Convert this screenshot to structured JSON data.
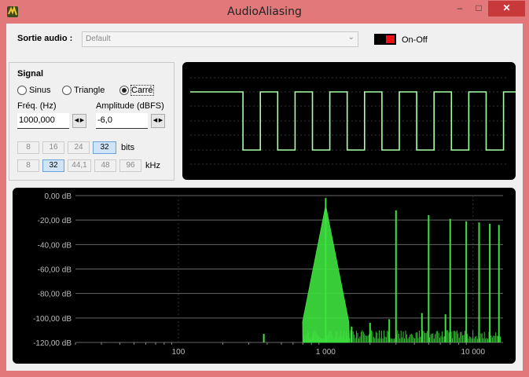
{
  "window": {
    "title": "AudioAliasing",
    "min_glyph": "–",
    "max_glyph": "□",
    "close_glyph": "✕"
  },
  "top": {
    "sortie_label": "Sortie audio :",
    "device": "Default",
    "onoff_label": "On-Off"
  },
  "signal": {
    "title": "Signal",
    "waveforms": [
      {
        "label": "Sinus",
        "checked": false
      },
      {
        "label": "Triangle",
        "checked": false
      },
      {
        "label": "Carré",
        "checked": true
      }
    ],
    "freq_label": "Fréq. (Hz)",
    "freq_value": "1000,000",
    "amp_label": "Amplitude (dBFS)",
    "amp_value": "-6,0",
    "bits_options": [
      "8",
      "16",
      "24",
      "32"
    ],
    "bits_selected": "32",
    "bits_label": "bits",
    "khz_options": [
      "8",
      "32",
      "44,1",
      "48",
      "96"
    ],
    "khz_selected": "32",
    "khz_label": "kHz"
  },
  "colors": {
    "trace": "#3ee23e",
    "oscillo_trace": "#a8ffa8",
    "grid": "#555555",
    "background": "#000000",
    "label": "#bbbbbb"
  },
  "chart_data": [
    {
      "type": "line",
      "title": "",
      "xlabel": "",
      "ylabel": "",
      "y_range": [
        -1,
        1
      ],
      "grid": true,
      "series": [
        {
          "values": [
            1,
            1,
            -1,
            1,
            -1,
            1,
            -1,
            1,
            -1,
            1,
            -1,
            1,
            -1,
            1,
            -1,
            1,
            -1,
            1,
            -1,
            1,
            -1,
            1,
            1
          ]
        }
      ]
    },
    {
      "type": "line",
      "title": "",
      "x_scale": "log",
      "x_range": [
        20,
        16000
      ],
      "ylim": [
        -120,
        0
      ],
      "grid": true,
      "y_ticks": [
        "0,00 dB",
        "-20,00 dB",
        "-40,00 dB",
        "-60,00 dB",
        "-80,00 dB",
        "-100,00 dB",
        "-120,00 dB"
      ],
      "y_tick_values": [
        0,
        -20,
        -40,
        -60,
        -80,
        -100,
        -120
      ],
      "x_ticks": [
        "100",
        "1 000",
        "10 000"
      ],
      "x_tick_values": [
        100,
        1000,
        10000
      ],
      "peaks": [
        {
          "x": 1000,
          "y": -2
        },
        {
          "x": 3000,
          "y": -12
        },
        {
          "x": 5000,
          "y": -16
        },
        {
          "x": 7000,
          "y": -19
        },
        {
          "x": 9000,
          "y": -21
        },
        {
          "x": 11000,
          "y": -22
        },
        {
          "x": 13000,
          "y": -23
        },
        {
          "x": 15000,
          "y": -24
        },
        {
          "x": 4500,
          "y": -96
        },
        {
          "x": 6500,
          "y": -97
        },
        {
          "x": 2000,
          "y": -104
        },
        {
          "x": 1500,
          "y": -107
        },
        {
          "x": 2700,
          "y": -101
        },
        {
          "x": 380,
          "y": -113
        }
      ]
    }
  ]
}
